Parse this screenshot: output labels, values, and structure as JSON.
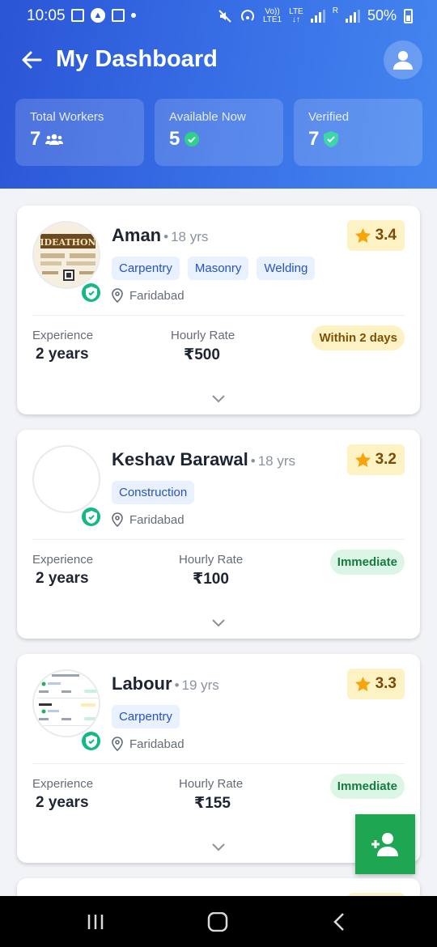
{
  "status_bar": {
    "time": "10:05",
    "network_top": "Vo))",
    "network_bottom": "LTE1",
    "lte_top": "LTE",
    "lte_bottom": "↓↑",
    "roaming": "R",
    "battery": "50%"
  },
  "header": {
    "title": "My Dashboard",
    "accent_color": "#2f63df"
  },
  "stats": [
    {
      "label": "Total Workers",
      "value": "7",
      "icon": "users-icon"
    },
    {
      "label": "Available Now",
      "value": "5",
      "icon": "check-circle-icon"
    },
    {
      "label": "Verified",
      "value": "7",
      "icon": "shield-check-icon"
    }
  ],
  "workers": [
    {
      "name": "Aman",
      "age": "18 yrs",
      "rating": "3.4",
      "skills": [
        "Carpentry",
        "Masonry",
        "Welding"
      ],
      "location": "Faridabad",
      "experience_label": "Experience",
      "experience": "2 years",
      "rate_label": "Hourly Rate",
      "rate": "₹500",
      "availability": "Within 2 days",
      "photo_text": "IDEATHON"
    },
    {
      "name": "Keshav Barawal",
      "age": "18 yrs",
      "rating": "3.2",
      "skills": [
        "Construction"
      ],
      "location": "Faridabad",
      "experience_label": "Experience",
      "experience": "2 years",
      "rate_label": "Hourly Rate",
      "rate": "₹100",
      "availability": "Immediate"
    },
    {
      "name": "Labour",
      "age": "19 yrs",
      "rating": "3.3",
      "skills": [
        "Carpentry"
      ],
      "location": "Faridabad",
      "experience_label": "Experience",
      "experience": "2 years",
      "rate_label": "Hourly Rate",
      "rate": "₹155",
      "availability": "Immediate"
    }
  ],
  "colors": {
    "verified": "#12b886",
    "star": "#f5a40a",
    "fab": "#1fa653"
  }
}
